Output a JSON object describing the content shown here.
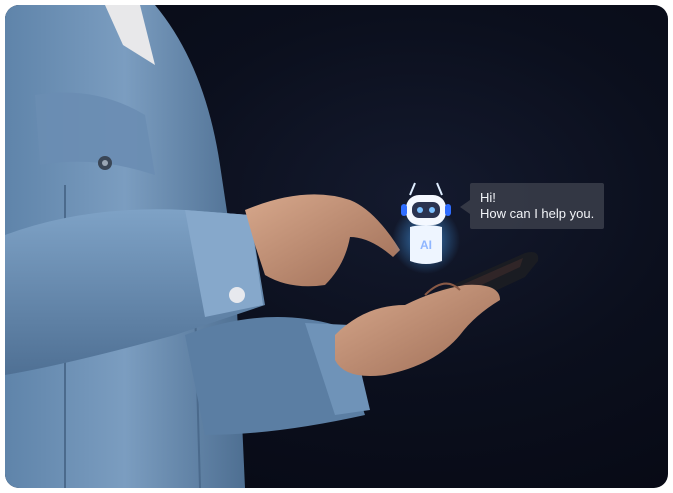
{
  "chat_bubble": {
    "line1": "Hi!",
    "line2": "How can I help you."
  },
  "robot": {
    "badge": "AI",
    "glow_color": "#4aa8ff"
  },
  "colors": {
    "background": "#0b0f1d",
    "denim": "#6f93b8",
    "skin": "#c9957a",
    "phone": "#1a1c22"
  }
}
